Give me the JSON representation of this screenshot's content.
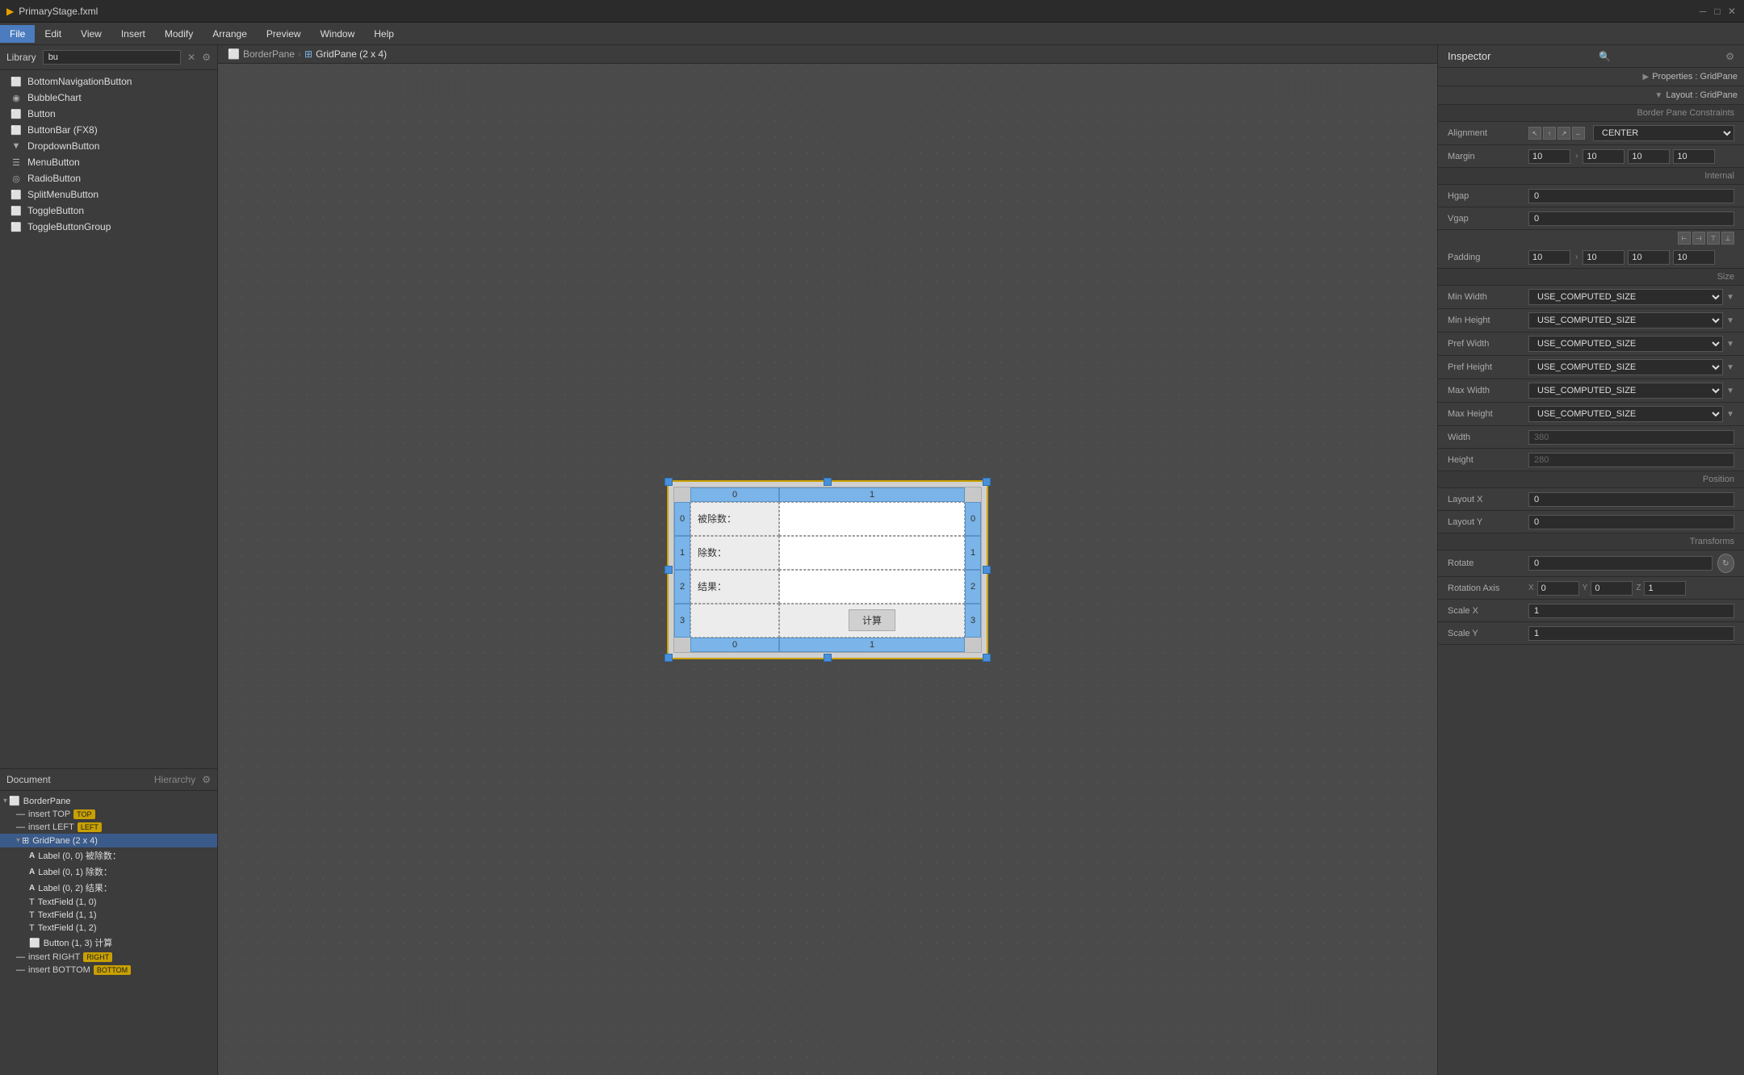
{
  "titlebar": {
    "title": "PrimaryStage.fxml",
    "icon": "▶"
  },
  "menubar": {
    "items": [
      "File",
      "Edit",
      "View",
      "Insert",
      "Modify",
      "Arrange",
      "Preview",
      "Window",
      "Help"
    ],
    "active": "File"
  },
  "library": {
    "label": "Library",
    "search_value": "bu",
    "items": [
      {
        "name": "BottomNavigationButton",
        "icon": "⬜"
      },
      {
        "name": "BubbleChart",
        "icon": "◉"
      },
      {
        "name": "Button",
        "icon": "⬜"
      },
      {
        "name": "ButtonBar  (FX8)",
        "icon": "⬜"
      },
      {
        "name": "DropdownButton",
        "icon": "▼"
      },
      {
        "name": "MenuButton",
        "icon": "☰"
      },
      {
        "name": "RadioButton",
        "icon": "◎"
      },
      {
        "name": "SplitMenuButton",
        "icon": "⬜"
      },
      {
        "name": "ToggleButton",
        "icon": "⬜"
      },
      {
        "name": "ToggleButtonGroup",
        "icon": "⬜"
      }
    ]
  },
  "document": {
    "label": "Document",
    "hierarchy_label": "Hierarchy",
    "tree": [
      {
        "label": "BorderPane",
        "indent": 0,
        "icon": "⬜",
        "expanded": true,
        "selected": false,
        "tag": null
      },
      {
        "label": "insert TOP",
        "indent": 1,
        "icon": "—",
        "expanded": false,
        "selected": false,
        "tag": "TOP"
      },
      {
        "label": "insert LEFT",
        "indent": 1,
        "icon": "—",
        "expanded": false,
        "selected": false,
        "tag": "LEFT"
      },
      {
        "label": "GridPane (2 x 4)",
        "indent": 1,
        "icon": "⊞",
        "expanded": true,
        "selected": true,
        "tag": null
      },
      {
        "label": "Label (0, 0)  被除数：",
        "indent": 2,
        "icon": "A",
        "expanded": false,
        "selected": false,
        "tag": null
      },
      {
        "label": "Label (0, 1)  除数：",
        "indent": 2,
        "icon": "A",
        "expanded": false,
        "selected": false,
        "tag": null
      },
      {
        "label": "Label (0, 2)  结果：",
        "indent": 2,
        "icon": "A",
        "expanded": false,
        "selected": false,
        "tag": null
      },
      {
        "label": "TextField (1, 0)",
        "indent": 2,
        "icon": "T",
        "expanded": false,
        "selected": false,
        "tag": null
      },
      {
        "label": "TextField (1, 1)",
        "indent": 2,
        "icon": "T",
        "expanded": false,
        "selected": false,
        "tag": null
      },
      {
        "label": "TextField (1, 2)",
        "indent": 2,
        "icon": "T",
        "expanded": false,
        "selected": false,
        "tag": null
      },
      {
        "label": "Button (1, 3)  计算",
        "indent": 2,
        "icon": "⬜",
        "expanded": false,
        "selected": false,
        "tag": null
      },
      {
        "label": "insert RIGHT",
        "indent": 1,
        "icon": "—",
        "expanded": false,
        "selected": false,
        "tag": "RIGHT"
      },
      {
        "label": "insert BOTTOM",
        "indent": 1,
        "icon": "—",
        "expanded": false,
        "selected": false,
        "tag": "BOTTOM"
      }
    ]
  },
  "breadcrumb": {
    "items": [
      {
        "label": "BorderPane",
        "icon": "⬜"
      },
      {
        "label": "GridPane (2 x 4)",
        "icon": "⊞"
      }
    ]
  },
  "canvas": {
    "grid": {
      "cols": [
        "0",
        "1"
      ],
      "rows": [
        "0",
        "1",
        "2",
        "3"
      ],
      "cells": [
        {
          "row": 0,
          "col": 0,
          "type": "label",
          "text": "被除数："
        },
        {
          "row": 0,
          "col": 1,
          "type": "input",
          "text": ""
        },
        {
          "row": 1,
          "col": 0,
          "type": "label",
          "text": "除数："
        },
        {
          "row": 1,
          "col": 1,
          "type": "input",
          "text": ""
        },
        {
          "row": 2,
          "col": 0,
          "type": "label",
          "text": "结果："
        },
        {
          "row": 2,
          "col": 1,
          "type": "input",
          "text": ""
        },
        {
          "row": 3,
          "col": 0,
          "type": "empty",
          "text": ""
        },
        {
          "row": 3,
          "col": 1,
          "type": "button",
          "text": "计算"
        }
      ]
    }
  },
  "inspector": {
    "title": "Inspector",
    "properties_tab": "Properties : GridPane",
    "layout_tab": "Layout : GridPane",
    "border_pane_constraints": "Border Pane Constraints",
    "alignment_label": "Alignment",
    "alignment_value": "CENTER",
    "margin_label": "Margin",
    "margin_values": [
      "10",
      "10",
      "10",
      "10"
    ],
    "internal_label": "Internal",
    "hgap_label": "Hgap",
    "hgap_value": "0",
    "vgap_label": "Vgap",
    "vgap_value": "0",
    "padding_label": "Padding",
    "padding_values": [
      "10",
      "10",
      "10",
      "10"
    ],
    "size_label": "Size",
    "min_width_label": "Min Width",
    "min_width_value": "USE_COMPUTED_SIZE",
    "min_height_label": "Min Height",
    "min_height_value": "USE_COMPUTED_SIZE",
    "pref_width_label": "Pref Width",
    "pref_width_value": "USE_COMPUTED_SIZE",
    "pref_height_label": "Pref Height",
    "pref_height_value": "USE_COMPUTED_SIZE",
    "max_width_label": "Max Width",
    "max_width_value": "USE_COMPUTED_SIZE",
    "max_height_label": "Max Height",
    "max_height_value": "USE_COMPUTED_SIZE",
    "width_label": "Width",
    "width_value": "380",
    "height_label": "Height",
    "height_value": "280",
    "position_label": "Position",
    "layout_x_label": "Layout X",
    "layout_x_value": "0",
    "layout_y_label": "Layout Y",
    "layout_y_value": "0",
    "transforms_label": "Transforms",
    "rotate_label": "Rotate",
    "rotate_value": "0",
    "rotation_axis_label": "Rotation Axis",
    "rotation_axis_x": "0",
    "rotation_axis_y": "0",
    "rotation_axis_z": "1",
    "scale_x_label": "Scale X",
    "scale_x_value": "1",
    "scale_y_label": "Scale Y",
    "scale_y_value": "1"
  }
}
